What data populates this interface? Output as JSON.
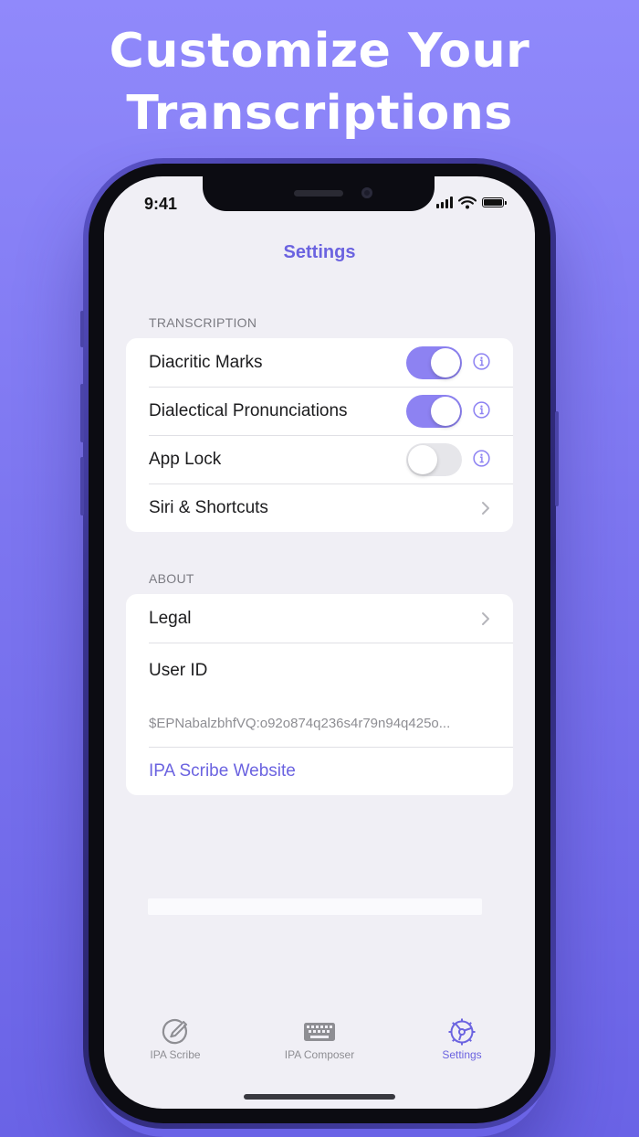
{
  "headline": {
    "line1": "Customize Your",
    "line2": "Transcriptions"
  },
  "status_bar": {
    "time": "9:41"
  },
  "nav": {
    "title": "Settings"
  },
  "sections": {
    "transcription": {
      "header": "TRANSCRIPTION",
      "rows": [
        {
          "label": "Diacritic Marks",
          "toggle": true
        },
        {
          "label": "Dialectical Pronunciations",
          "toggle": true
        },
        {
          "label": "App Lock",
          "toggle": false
        },
        {
          "label": "Siri & Shortcuts"
        }
      ]
    },
    "about": {
      "header": "ABOUT",
      "legal": "Legal",
      "user_id_label": "User ID",
      "user_id_value": "$EPNabalzbhfVQ:o92o874q236s4r79n94q425o...",
      "website": "IPA Scribe Website"
    }
  },
  "tabs": [
    {
      "label": "IPA Scribe",
      "icon": "pencil-circle-icon"
    },
    {
      "label": "IPA Composer",
      "icon": "keyboard-icon"
    },
    {
      "label": "Settings",
      "icon": "gear-icon",
      "active": true
    }
  ],
  "colors": {
    "accent": "#6b63e0",
    "toggle_on": "#8d82f2",
    "background": "#8d86f8"
  }
}
